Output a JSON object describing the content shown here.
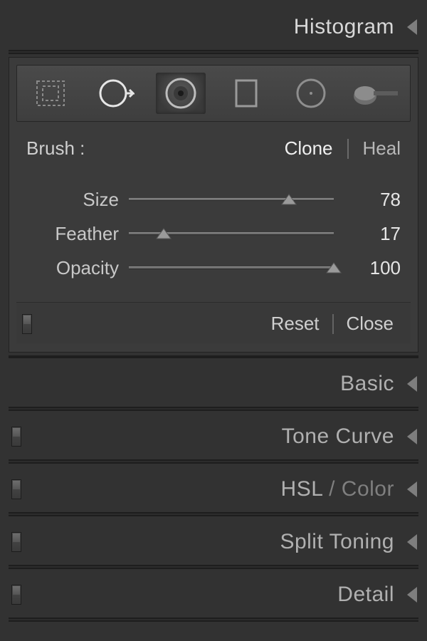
{
  "header": {
    "histogram": "Histogram"
  },
  "toolbar": {
    "tools": [
      {
        "name": "crop-tool"
      },
      {
        "name": "spot-removal-tool"
      },
      {
        "name": "red-eye-tool"
      },
      {
        "name": "graduated-filter-tool"
      },
      {
        "name": "radial-filter-tool"
      },
      {
        "name": "brush-tool"
      }
    ],
    "selected_index": 2
  },
  "brush": {
    "label": "Brush :",
    "mode_clone": "Clone",
    "mode_heal": "Heal",
    "active_mode": "Clone"
  },
  "sliders": {
    "size": {
      "label": "Size",
      "value": 78,
      "min": 0,
      "max": 100
    },
    "feather": {
      "label": "Feather",
      "value": 17,
      "min": 0,
      "max": 100
    },
    "opacity": {
      "label": "Opacity",
      "value": 100,
      "min": 0,
      "max": 100
    }
  },
  "footer": {
    "reset": "Reset",
    "close": "Close"
  },
  "panels": {
    "basic": {
      "label": "Basic",
      "has_switch": false
    },
    "tone_curve": {
      "label": "Tone Curve",
      "has_switch": true
    },
    "hsl_color": {
      "label_main": "HSL",
      "label_sep": " / ",
      "label_sub": "Color",
      "has_switch": true
    },
    "split_toning": {
      "label": "Split Toning",
      "has_switch": true
    },
    "detail": {
      "label": "Detail",
      "has_switch": true
    }
  }
}
